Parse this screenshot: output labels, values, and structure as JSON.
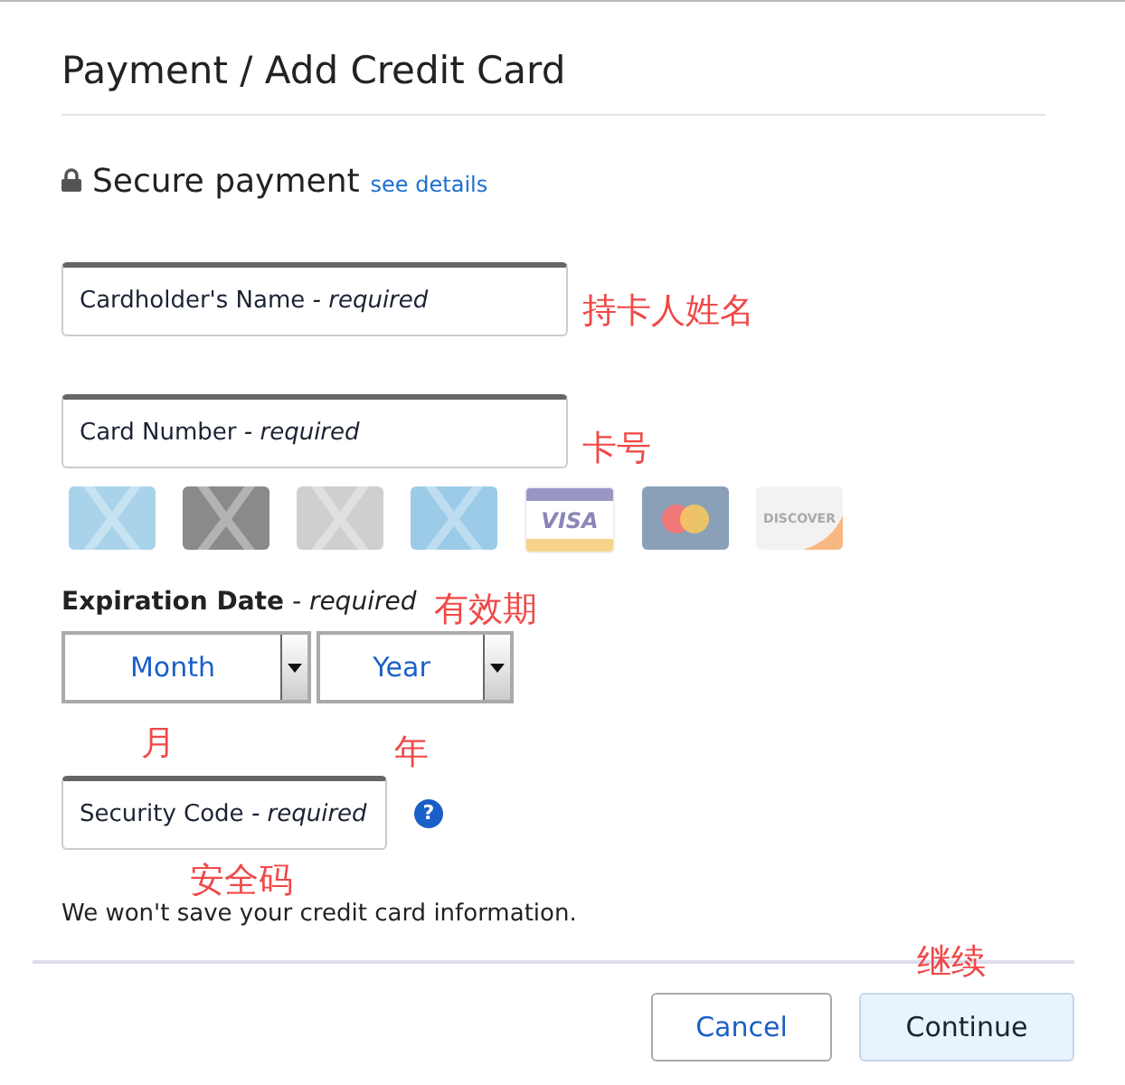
{
  "title": "Payment / Add Credit Card",
  "secure": {
    "label": "Secure payment",
    "link": "see details"
  },
  "fields": [
    {
      "kind": "text",
      "label": "Cardholder's Name *- required*",
      "annotation": "持卡人姓名"
    },
    {
      "kind": "text",
      "label": "Card Number *- required*",
      "annotation": "卡号"
    }
  ],
  "cards": [
    {
      "kind": "store",
      "color": "#a9d3ea"
    },
    {
      "kind": "store",
      "color": "#8a8a8a"
    },
    {
      "kind": "store",
      "color": "#cfcfcf"
    },
    {
      "kind": "store",
      "color": "#9ccbe8"
    },
    {
      "kind": "visa",
      "label": "VISA",
      "color": "#9a96c4"
    },
    {
      "kind": "mastercard",
      "color": "#8aa0b8"
    },
    {
      "kind": "discover",
      "label": "DISCOVER",
      "color": "#f2f2f2"
    }
  ],
  "expiration": {
    "label": "**Expiration Date** *- required*",
    "annotation": "有效期",
    "selects": [
      {
        "value": "Month",
        "annotation": "月"
      },
      {
        "value": "Year",
        "annotation": "年"
      }
    ]
  },
  "security": {
    "label": "Security Code *- required*",
    "annotation": "安全码",
    "help": "?"
  },
  "note": "We won't save your credit card information.",
  "buttons": [
    {
      "label": "Cancel",
      "kind": "secondary"
    },
    {
      "label": "Continue",
      "kind": "primary",
      "annotation": "继续"
    }
  ]
}
